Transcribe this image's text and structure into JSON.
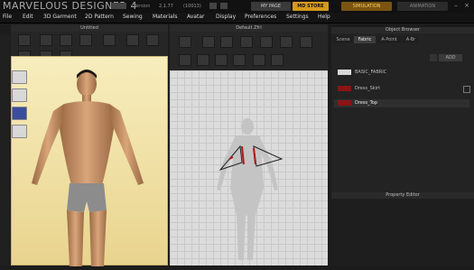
{
  "app": {
    "logo": "MARVELOUS DESIGNER 4",
    "version_label": "Version",
    "version": "2.1.77",
    "build": "(10013)",
    "my_page": "MY PAGE",
    "md_store": "MD STORE",
    "simulation": "SIMULATION",
    "animation": "ANIMATION",
    "accent": "#d49a1c"
  },
  "menu": [
    "File",
    "Edit",
    "3D Garment",
    "2D Pattern",
    "Sewing",
    "Materials",
    "Avatar",
    "Display",
    "Preferences",
    "Settings",
    "Help"
  ],
  "panels": {
    "view3d_title": "Untitled",
    "view2d_title": "Default.Zfrl",
    "object_browser_title": "Object Browser",
    "property_editor_title": "Property Editor"
  },
  "object_browser": {
    "tabs": [
      "Scene",
      "Fabric",
      "A-Point",
      "A-Br"
    ],
    "active_tab": "Fabric",
    "add_label": "ADD",
    "fabrics": [
      {
        "name": "BASIC_FABRIC",
        "color": "#d8d8d8"
      },
      {
        "name": "Dress_Skirt",
        "color": "#8b1414"
      },
      {
        "name": "Dress_Top",
        "color": "#8b1414"
      }
    ]
  }
}
